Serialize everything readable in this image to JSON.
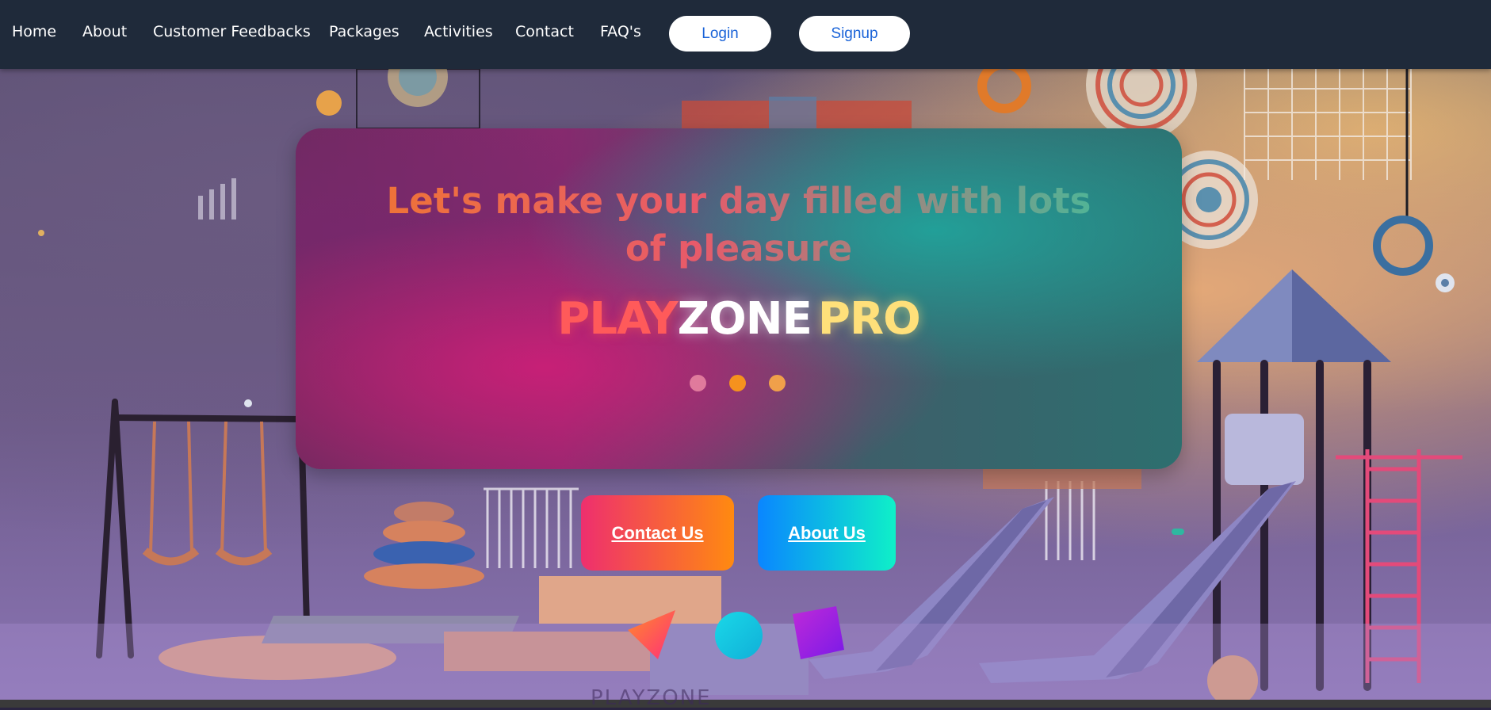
{
  "nav": {
    "items": [
      {
        "label": "Home"
      },
      {
        "label": "About"
      },
      {
        "label": "Customer Feedbacks"
      },
      {
        "label": "Packages"
      },
      {
        "label": "Activities"
      },
      {
        "label": "Contact"
      },
      {
        "label": "FAQ's"
      }
    ],
    "login_label": "Login",
    "signup_label": "Signup"
  },
  "hero": {
    "tagline": "Let's make your day filled with lots of pleasure",
    "brand": {
      "part1": "PLAY",
      "part2": "ZONE",
      "part3": "PRO"
    },
    "slide_dots": [
      {
        "color": "#e07a9c"
      },
      {
        "color": "#f5921e"
      },
      {
        "color": "#f0a04a"
      }
    ],
    "contact_button": "Contact Us",
    "about_button": "About Us",
    "watermark": "PLAYZONE"
  },
  "colors": {
    "nav_bg": "#1f2a3a",
    "pill_text": "#1a63d8",
    "contact_gradient": [
      "#ee2f6e",
      "#ff8a10"
    ],
    "about_gradient": [
      "#0a86ff",
      "#0ff0c8"
    ]
  }
}
